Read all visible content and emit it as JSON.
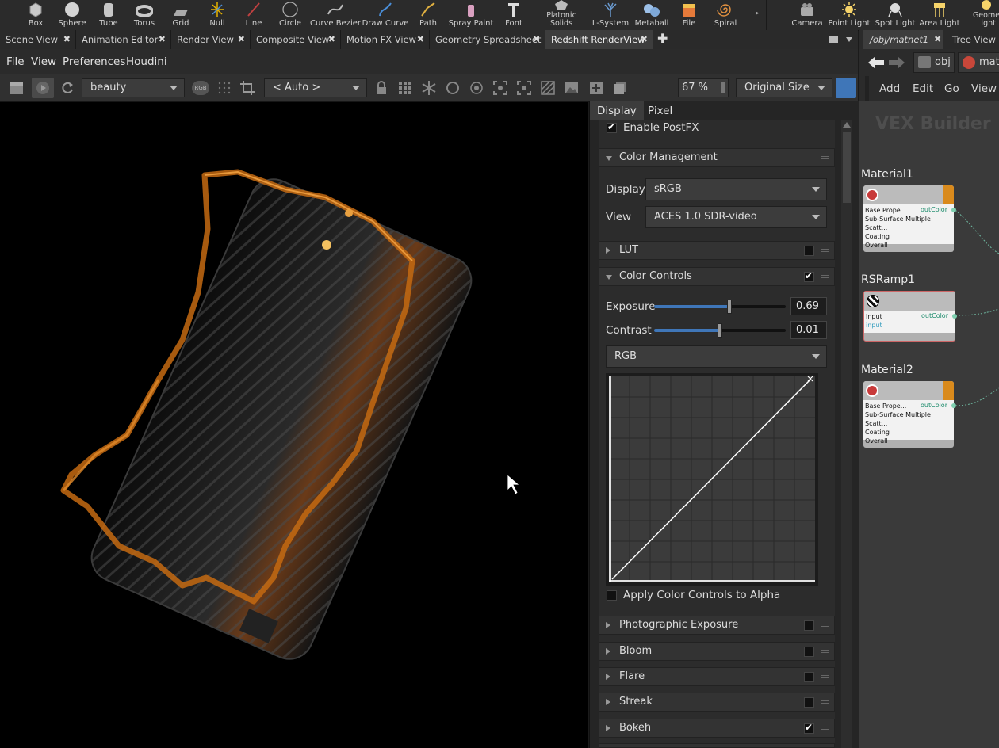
{
  "shelf": {
    "left_tools": [
      {
        "label": "Box",
        "icon": "box-icon"
      },
      {
        "label": "Sphere",
        "icon": "sphere-icon"
      },
      {
        "label": "Tube",
        "icon": "tube-icon"
      },
      {
        "label": "Torus",
        "icon": "torus-icon"
      },
      {
        "label": "Grid",
        "icon": "grid-icon"
      },
      {
        "label": "Null",
        "icon": "null-icon"
      },
      {
        "label": "Line",
        "icon": "line-icon"
      },
      {
        "label": "Circle",
        "icon": "circle-icon"
      },
      {
        "label": "Curve Bezier",
        "icon": "curve-bezier-icon"
      },
      {
        "label": "Draw Curve",
        "icon": "draw-curve-icon"
      },
      {
        "label": "Path",
        "icon": "path-icon"
      },
      {
        "label": "Spray Paint",
        "icon": "spray-paint-icon"
      },
      {
        "label": "Font",
        "icon": "font-icon"
      },
      {
        "label": "Platonic Solids",
        "icon": "platonic-solids-icon"
      },
      {
        "label": "L-System",
        "icon": "l-system-icon"
      },
      {
        "label": "Metaball",
        "icon": "metaball-icon"
      },
      {
        "label": "File",
        "icon": "file-icon"
      },
      {
        "label": "Spiral",
        "icon": "spiral-icon"
      }
    ],
    "right_tools": [
      {
        "label": "Camera",
        "icon": "camera-icon"
      },
      {
        "label": "Point Light",
        "icon": "point-light-icon"
      },
      {
        "label": "Spot Light",
        "icon": "spot-light-icon"
      },
      {
        "label": "Area Light",
        "icon": "area-light-icon"
      },
      {
        "label": "Geome Light",
        "icon": "geometry-light-icon"
      }
    ]
  },
  "tabs": [
    {
      "label": "Scene View"
    },
    {
      "label": "Animation Editor"
    },
    {
      "label": "Render View"
    },
    {
      "label": "Composite View"
    },
    {
      "label": "Motion FX View"
    },
    {
      "label": "Geometry Spreadsheet"
    },
    {
      "label": "Redshift RenderView",
      "active": true
    }
  ],
  "menu": [
    "File",
    "View",
    "Preferences",
    "Houdini"
  ],
  "toolbar": {
    "aov": "beauty",
    "camera": "< Auto >",
    "zoom": "67 %",
    "size": "Original Size"
  },
  "panel": {
    "tabs": [
      "Display",
      "Pixel"
    ],
    "enable_postfx": "Enable PostFX",
    "color_management": {
      "title": "Color Management",
      "display_label": "Display",
      "display_value": "sRGB",
      "view_label": "View",
      "view_value": "ACES 1.0 SDR-video"
    },
    "lut": "LUT",
    "color_controls": {
      "title": "Color Controls",
      "exposure_label": "Exposure",
      "exposure_value": "0.69",
      "exposure_fill": 0.57,
      "contrast_label": "Contrast",
      "contrast_value": "0.01",
      "contrast_fill": 0.5,
      "channel": "RGB",
      "apply_alpha": "Apply Color Controls to Alpha"
    },
    "sections": [
      {
        "label": "Photographic Exposure",
        "checked": false
      },
      {
        "label": "Bloom",
        "checked": false
      },
      {
        "label": "Flare",
        "checked": false
      },
      {
        "label": "Streak",
        "checked": false
      },
      {
        "label": "Bokeh",
        "checked": true
      }
    ]
  },
  "network": {
    "tabs": [
      "/obj/matnet1",
      "Tree View"
    ],
    "path": [
      "obj",
      "matn"
    ],
    "menu": [
      "Add",
      "Edit",
      "Go",
      "View"
    ],
    "watermark": "VEX Builder",
    "nodes": [
      {
        "name": "Material1",
        "rows": [
          "Base Prope...",
          "Sub-Surface Multiple Scatt...",
          "Coating",
          "Overall"
        ],
        "out": "outColor"
      },
      {
        "name": "RSRamp1",
        "rows": [
          "Input",
          "input"
        ],
        "out": "outColor"
      },
      {
        "name": "Material2",
        "rows": [
          "Base Prope...",
          "Sub-Surface Multiple Scatt...",
          "Coating",
          "Overall"
        ],
        "out": "outColor"
      }
    ]
  },
  "colors": {
    "accent_blue": "#3f76b8",
    "material_orange": "#d98a1c",
    "ember": "#c46a12"
  }
}
